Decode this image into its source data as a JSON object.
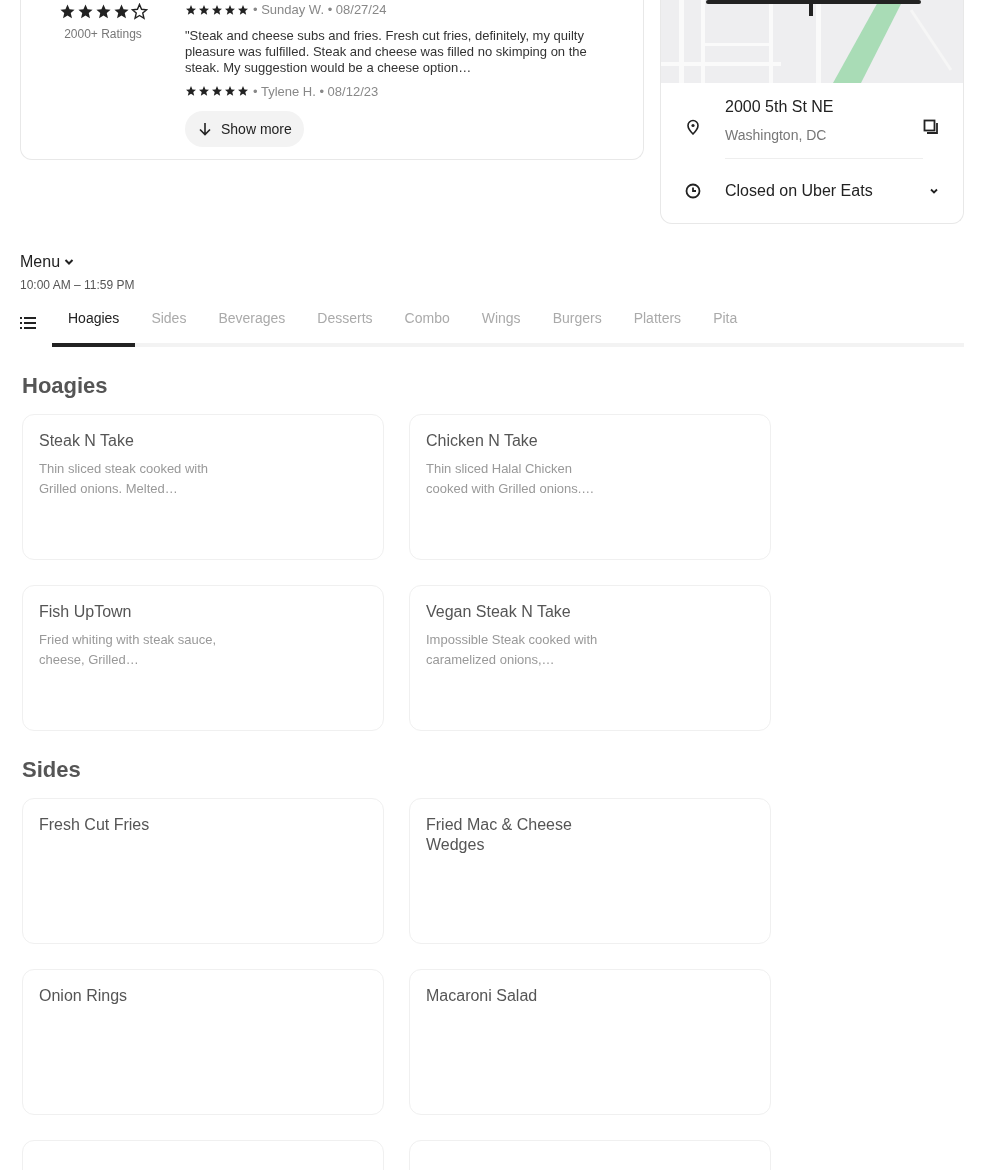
{
  "rating_summary": {
    "stars": 4,
    "count_label": "2000+ Ratings"
  },
  "reviews": [
    {
      "stars": 5,
      "meta": "• Sunday W. • 08/27/24"
    },
    {
      "text": "\"Steak and cheese subs and fries. Fresh cut fries, definitely, my quilty pleasure was fulfilled. Steak and cheese was filled no skimping on the steak. My suggestion would be a cheese option…",
      "stars": 5,
      "meta": "• Tylene H. • 08/12/23"
    }
  ],
  "show_more": "Show more",
  "location": {
    "address": "2000 5th St NE",
    "city": "Washington, DC",
    "hours_status": "Closed on Uber Eats"
  },
  "menu": {
    "title": "Menu",
    "hours": "10:00 AM – 11:59 PM"
  },
  "tabs": [
    {
      "label": "Hoagies",
      "selected": true
    },
    {
      "label": "Sides",
      "selected": false
    },
    {
      "label": "Beverages",
      "selected": false
    },
    {
      "label": "Desserts",
      "selected": false
    },
    {
      "label": "Combo",
      "selected": false
    },
    {
      "label": "Wings",
      "selected": false
    },
    {
      "label": "Burgers",
      "selected": false
    },
    {
      "label": "Platters",
      "selected": false
    },
    {
      "label": "Pita",
      "selected": false
    }
  ],
  "sections": [
    {
      "title": "Hoagies",
      "items": [
        {
          "kind": "item",
          "name": "Steak N Take",
          "description": "Thin sliced steak cooked with Grilled onions. Melted…"
        },
        {
          "kind": "item",
          "name": "Chicken N Take",
          "description": "Thin sliced Halal Chicken cooked with Grilled onions.…"
        },
        {
          "kind": "item",
          "name": "Fish UpTown",
          "description": "Fried whiting with steak sauce, cheese, Grilled…"
        },
        {
          "kind": "item",
          "name": "Vegan Steak N Take",
          "description": "Impossible Steak cooked with caramelized onions,…"
        }
      ]
    },
    {
      "title": "Sides",
      "items": [
        {
          "kind": "item",
          "name": "Fresh Cut Fries"
        },
        {
          "kind": "item",
          "name": "Fried Mac & Cheese Wedges"
        },
        {
          "kind": "item",
          "name": "Onion Rings"
        },
        {
          "kind": "item",
          "name": "Macaroni Salad"
        },
        {
          "kind": "cut_off"
        },
        {
          "kind": "cut_off"
        }
      ]
    }
  ]
}
